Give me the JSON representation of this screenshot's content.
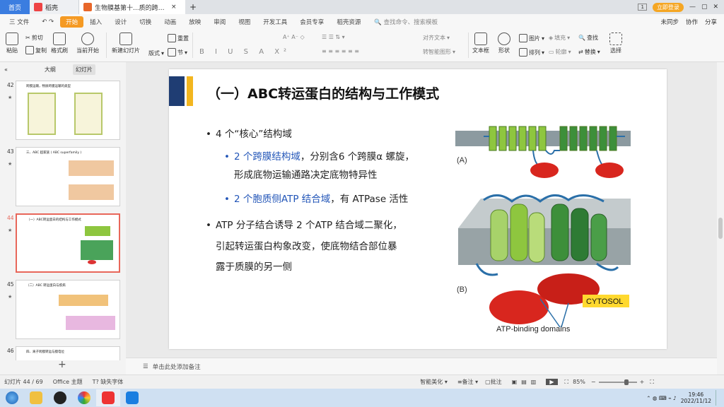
{
  "tabs": [
    {
      "label": "首页"
    },
    {
      "label": "稻壳"
    },
    {
      "label": "生物膜基第十...质的跨膜运输"
    }
  ],
  "topright": {
    "badge": "1",
    "login": "立即登录"
  },
  "menu": {
    "file": "三 文件",
    "start": "开始",
    "items": [
      "插入",
      "设计",
      "切换",
      "动画",
      "放映",
      "审阅",
      "视图",
      "开发工具",
      "会员专享",
      "稻壳资源"
    ],
    "search": "查找命令、搜索模板",
    "right": [
      "未同步",
      "协作",
      "分享"
    ]
  },
  "ribbon": {
    "paste": "粘贴",
    "cut": "剪切",
    "copy": "复制",
    "format_painter": "格式刷",
    "from_current": "当前开始",
    "new_slide": "新建幻灯片",
    "layout": "版式",
    "section": "节",
    "reset": "重置",
    "text_box": "文本框",
    "shape": "形状",
    "picture": "图片",
    "arrange": "排列",
    "fill": "填充",
    "outline": "轮廓",
    "find": "查找",
    "replace": "替换",
    "select": "选择",
    "align_text": "对齐文本",
    "smartart": "转智能图形"
  },
  "leftpanel": {
    "tab_outline": "大纲",
    "tab_slides": "幻灯片",
    "thumbs": [
      {
        "num": "42",
        "title": "跨膜运输，物质跨膜运输的类型"
      },
      {
        "num": "43",
        "title": "三、ABC 超家族 ( ABC superfamily )"
      },
      {
        "num": "44",
        "title": "（一）ABC转运蛋白的结构与工作模式"
      },
      {
        "num": "45",
        "title": "（二）ABC 转运蛋白与疾病"
      },
      {
        "num": "46",
        "title": "四、离子跨膜转运与膜电位"
      }
    ]
  },
  "slide": {
    "title": "（一）ABC转运蛋白的结构与工作模式",
    "b1": "4 个“核心”结构域",
    "b1a_blue": "2 个跨膜结构域",
    "b1a_rest": "，分别含6 个跨膜α 螺旋，",
    "b1a_line2": "形成底物运输通路决定底物特异性",
    "b1b_blue": "2 个胞质侧ATP 结合域",
    "b1b_rest": "，有 ATPase 活性",
    "b2_l1": "ATP 分子结合诱导 2 个ATP 结合域二聚化，",
    "b2_l2": "引起转运蛋白构象改变，使底物结合部位暴",
    "b2_l3": "露于质膜的另一侧",
    "fig_a": "(A)",
    "fig_b": "(B)",
    "cytosol": "CYTOSOL",
    "atp_caption": "ATP-binding domains"
  },
  "notes": "单击此处添加备注",
  "status": {
    "slide_pos": "幻灯片 44 / 69",
    "theme": "Office 主题",
    "missing_font": "缺失字体",
    "smart_beautify": "智能美化",
    "remarks": "备注",
    "comments": "批注",
    "zoom": "85%"
  },
  "clock": {
    "time": "19:46",
    "date": "2022/11/12"
  },
  "colors": {
    "accent_blue": "#1f3d73",
    "accent_yellow": "#f3b61f",
    "start_orange": "#f59a23",
    "link_blue": "#2356b8"
  }
}
